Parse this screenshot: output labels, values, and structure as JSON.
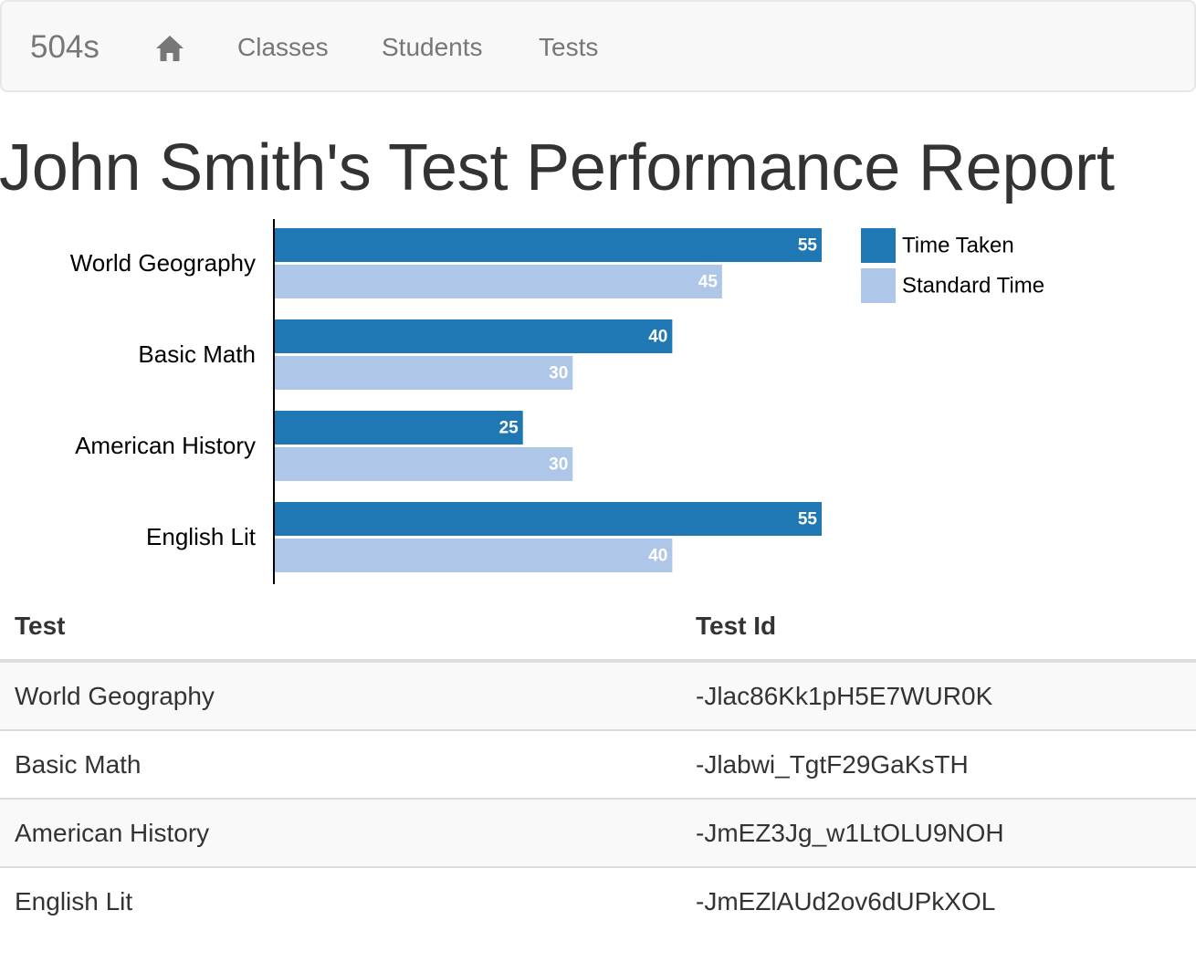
{
  "navbar": {
    "brand": "504s",
    "home_icon": "home-icon",
    "links": [
      "Classes",
      "Students",
      "Tests"
    ]
  },
  "page": {
    "title": "John Smith's Test Performance Report"
  },
  "chart_data": {
    "type": "bar",
    "orientation": "horizontal",
    "categories": [
      "World Geography",
      "Basic Math",
      "American History",
      "English Lit"
    ],
    "series": [
      {
        "name": "Time Taken",
        "values": [
          55,
          40,
          25,
          55
        ],
        "color": "#1f77b4"
      },
      {
        "name": "Standard Time",
        "values": [
          45,
          30,
          30,
          40
        ],
        "color": "#aec7e8"
      }
    ],
    "xlim": [
      0,
      55
    ],
    "legend": "right",
    "data_labels": true,
    "grid": false
  },
  "table": {
    "headers": [
      "Test",
      "Test Id"
    ],
    "rows": [
      [
        "World Geography",
        "-Jlac86Kk1pH5E7WUR0K"
      ],
      [
        "Basic Math",
        "-Jlabwi_TgtF29GaKsTH"
      ],
      [
        "American History",
        "-JmEZ3Jg_w1LtOLU9NOH"
      ],
      [
        "English Lit",
        "-JmEZlAUd2ov6dUPkXOL"
      ]
    ]
  }
}
